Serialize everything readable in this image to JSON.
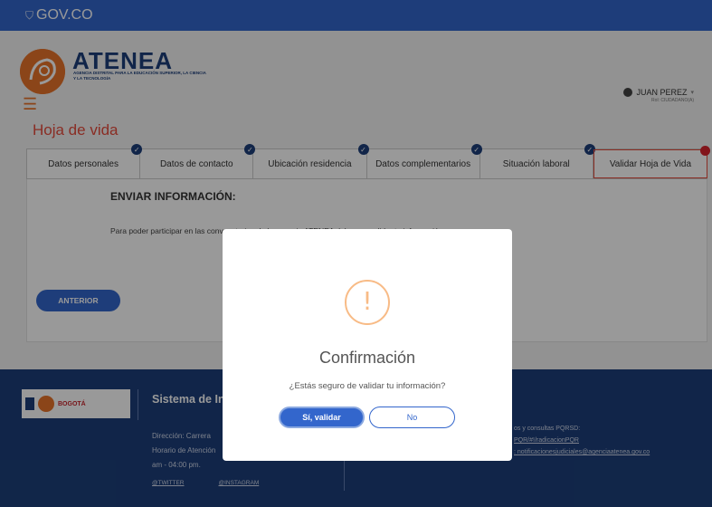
{
  "govbar": {
    "brand": "GOV.CO",
    "icon": "colombia-shield-icon"
  },
  "header": {
    "logo_name": "ATENEA",
    "logo_subtitle": "AGENCIA DISTRITAL PARA LA EDUCACIÓN SUPERIOR, LA CIENCIA Y LA TECNOLOGÍA",
    "menu_icon": "hamburger-icon",
    "user_name": "JUAN PEREZ",
    "user_role": "Rol: CIUDADANO(A)",
    "user_icon": "user-icon"
  },
  "main": {
    "page_title": "Hoja de vida",
    "tabs": [
      {
        "label": "Datos personales",
        "completed": true
      },
      {
        "label": "Datos de contacto",
        "completed": true
      },
      {
        "label": "Ubicación residencia",
        "completed": true
      },
      {
        "label": "Datos complementarios",
        "completed": true
      },
      {
        "label": "Situación laboral",
        "completed": true
      },
      {
        "label": "Validar Hoja de Vida",
        "active": true
      }
    ],
    "section_title": "ENVIAR INFORMACIÓN:",
    "section_text": "Para poder participar en las convocatorias de la agencia ATENEA debemos validar tu información",
    "prev_button": "ANTERIOR"
  },
  "footer": {
    "logo_text": "BOGOTÁ",
    "title": "Sistema de Información Agencia Atenea",
    "address": "Dirección: Carrera",
    "hours_1": "Horario de Atención",
    "hours_2": "am - 04:00 pm.",
    "twitter": "@TWITTER",
    "instagram": "@INSTAGRAM",
    "contact_1": "os y consultas PQRSD:",
    "contact_2": "PQR/#!/radicacionPQR",
    "contact_3": ": notificacionesjudiciales@agenciaatenea.gov.co"
  },
  "modal": {
    "icon": "warning-exclamation-icon",
    "icon_glyph": "!",
    "title": "Confirmación",
    "text": "¿Estás seguro de validar tu información?",
    "confirm_label": "Sí, validar",
    "cancel_label": "No"
  },
  "colors": {
    "primary": "#3366cc",
    "brand_orange": "#e8742a",
    "navy": "#1d3f7a",
    "accent_red": "#e64b3c",
    "warning": "#f8bb86"
  }
}
